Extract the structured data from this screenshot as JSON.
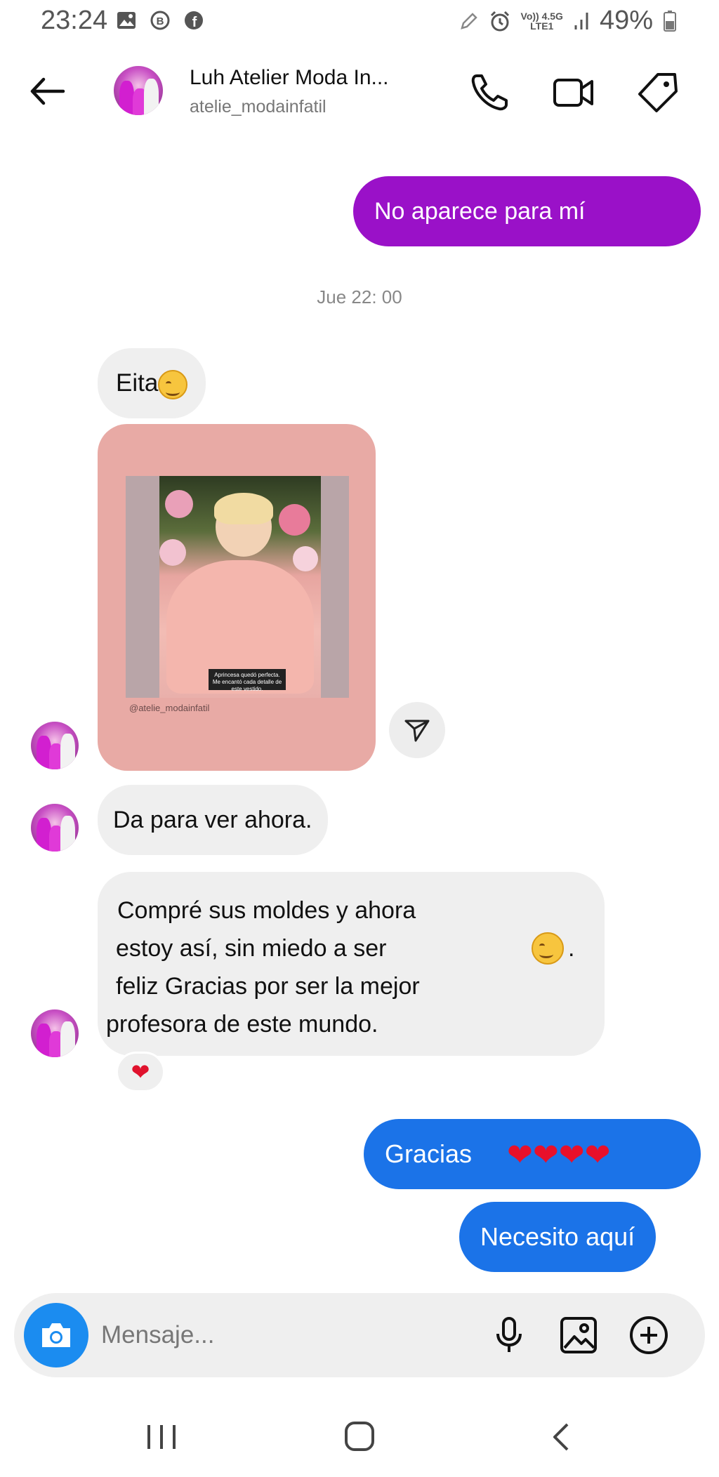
{
  "status_bar": {
    "time": "23:24",
    "network_top": "Vo)) 4.5G",
    "network_bottom": "LTE1",
    "battery": "49%"
  },
  "header": {
    "name": "Luh Atelier Moda In...",
    "handle": "atelie_modainfatil"
  },
  "messages": {
    "out1": "No aparece para mí",
    "timestamp": "Jue 22: 00",
    "in1": "Eita",
    "post": {
      "caption_line1": "Aprincesa quedó perfecta.",
      "caption_line2": "Me encantó cada detalle de este vestido.",
      "handle": "@atelie_modainfatil"
    },
    "in2": "Da para ver ahora.",
    "in3_line1": "Compré sus moldes y ahora",
    "in3_line2": "estoy así, sin miedo a ser",
    "in3_line3": "feliz Gracias por ser la mejor",
    "in3_line4": "profesora de este mundo.",
    "in3_reaction": "❤",
    "out2": "Gracias",
    "out2_hearts": "❤❤❤❤",
    "out3": "Necesito aquí"
  },
  "composer": {
    "placeholder": "Mensaje..."
  },
  "colors": {
    "purple_bubble": "#9a11c8",
    "blue_bubble": "#1b73e8",
    "incoming_bubble": "#efefef",
    "camera_button": "#1b8cf0"
  },
  "icons": {
    "header": [
      "back-arrow-icon",
      "phone-icon",
      "video-camera-icon",
      "tag-icon"
    ],
    "composer": [
      "camera-icon",
      "microphone-icon",
      "image-icon",
      "plus-circle-icon"
    ],
    "nav": [
      "recent-apps-icon",
      "home-icon",
      "back-icon"
    ]
  }
}
